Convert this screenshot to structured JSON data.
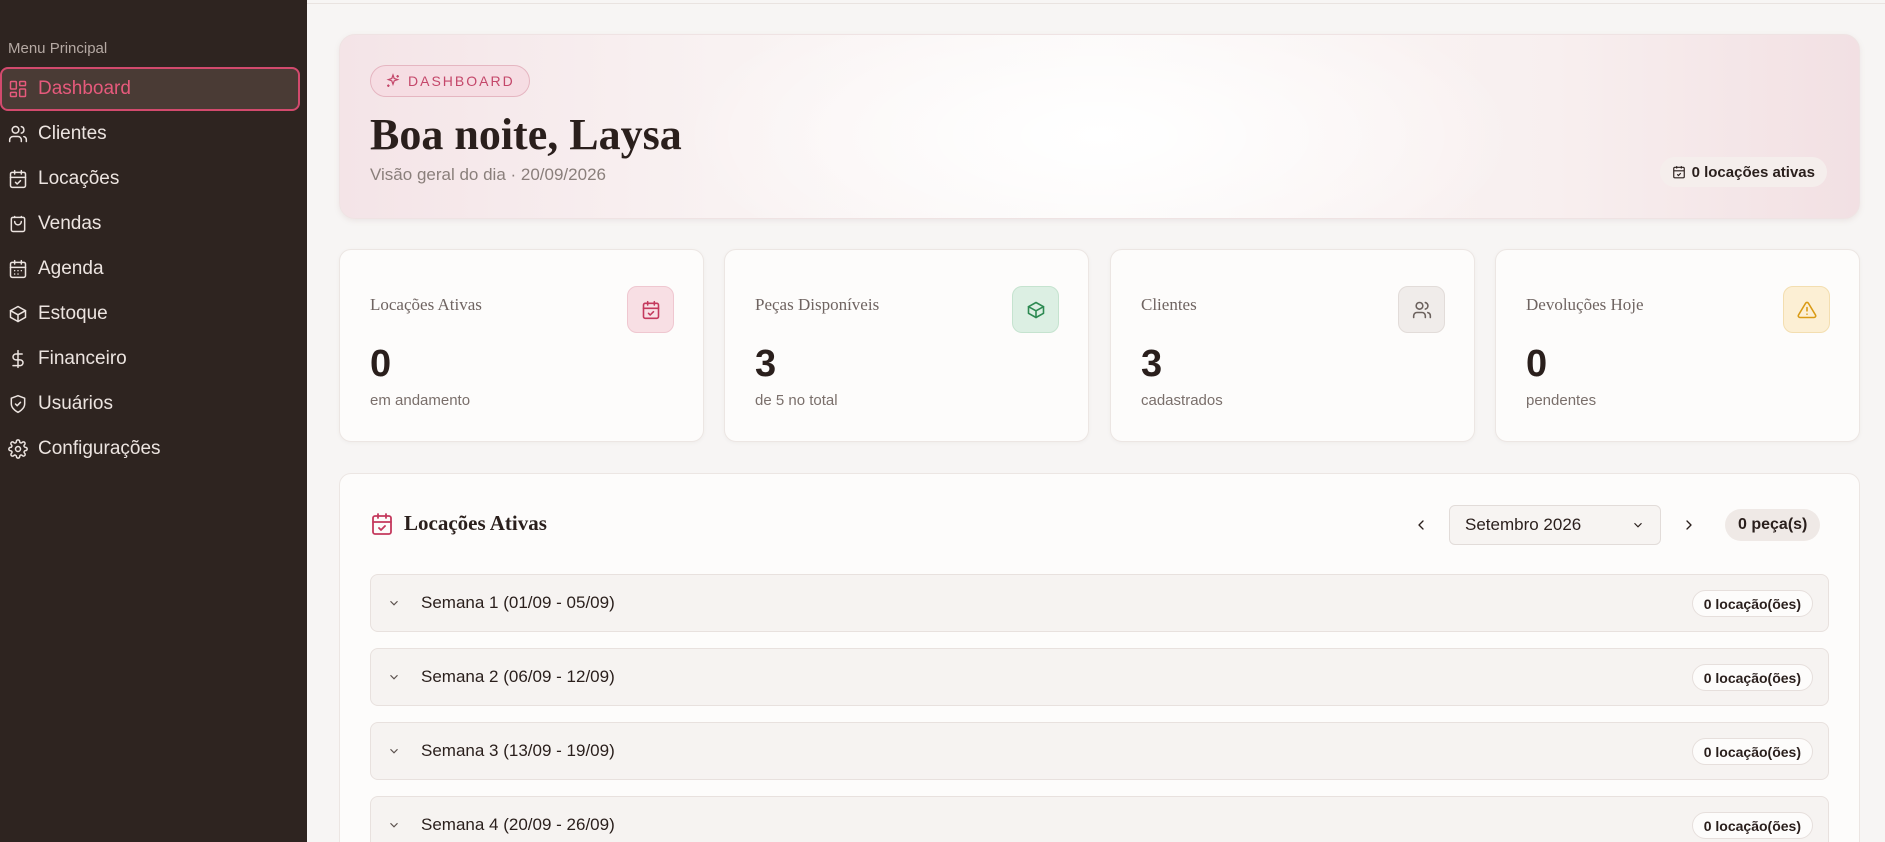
{
  "sidebar": {
    "heading": "Menu Principal",
    "items": [
      {
        "label": "Dashboard",
        "icon": "layout-grid-icon",
        "active": true
      },
      {
        "label": "Clientes",
        "icon": "users-icon"
      },
      {
        "label": "Locações",
        "icon": "calendar-check-icon"
      },
      {
        "label": "Vendas",
        "icon": "shopping-bag-icon"
      },
      {
        "label": "Agenda",
        "icon": "calendar-icon"
      },
      {
        "label": "Estoque",
        "icon": "package-icon"
      },
      {
        "label": "Financeiro",
        "icon": "dollar-icon"
      },
      {
        "label": "Usuários",
        "icon": "shield-check-icon"
      },
      {
        "label": "Configurações",
        "icon": "gear-icon"
      }
    ]
  },
  "hero": {
    "badge": "DASHBOARD",
    "title": "Boa noite, Laysa",
    "subtitle": "Visão geral do dia · 20/09/2026",
    "active_pill": "0 locações ativas"
  },
  "stats": [
    {
      "label": "Locações Ativas",
      "value": "0",
      "note": "em andamento",
      "icon": "calendar-check-icon",
      "color": "#c4395d"
    },
    {
      "label": "Peças Disponíveis",
      "value": "3",
      "note": "de 5 no total",
      "icon": "package-icon",
      "color": "#2d8a52"
    },
    {
      "label": "Clientes",
      "value": "3",
      "note": "cadastrados",
      "icon": "users-icon",
      "color": "#6b615d"
    },
    {
      "label": "Devoluções Hoje",
      "value": "0",
      "note": "pendentes",
      "icon": "alert-triangle-icon",
      "color": "#d99a14"
    }
  ],
  "rentals": {
    "title": "Locações Ativas",
    "month": "Setembro 2026",
    "pieces": "0 peça(s)",
    "weeks": [
      {
        "label": "Semana 1 (01/09 - 05/09)",
        "count": "0 locação(ões)"
      },
      {
        "label": "Semana 2 (06/09 - 12/09)",
        "count": "0 locação(ões)"
      },
      {
        "label": "Semana 3 (13/09 - 19/09)",
        "count": "0 locação(ões)"
      },
      {
        "label": "Semana 4 (20/09 - 26/09)",
        "count": "0 locação(ões)"
      }
    ]
  },
  "colors": {
    "accent": "#e65a7c",
    "sidebar": "#2e2420",
    "background": "#f7f5f4"
  }
}
